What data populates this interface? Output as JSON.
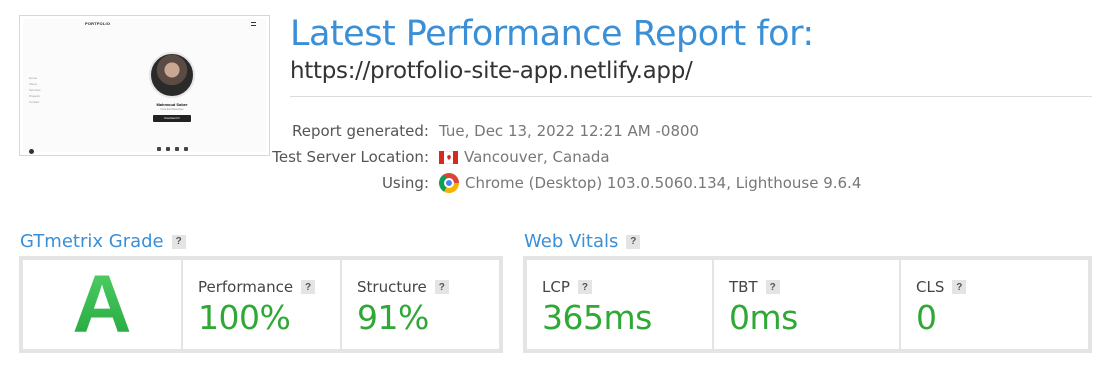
{
  "thumbnail": {
    "brand": "PORTFOLIO",
    "nav_items": [
      "Home",
      "About",
      "Services",
      "Projects",
      "Contact"
    ],
    "name": "Mahmoud Saber",
    "role": "Front-End Developer",
    "button": "Download CV"
  },
  "header": {
    "title": "Latest Performance Report for:",
    "url": "https://protfolio-site-app.netlify.app/"
  },
  "info": {
    "generated_label": "Report generated:",
    "generated_value": "Tue, Dec 13, 2022 12:21 AM -0800",
    "location_label": "Test Server Location:",
    "location_value": "Vancouver, Canada",
    "using_label": "Using:",
    "using_value": "Chrome (Desktop) 103.0.5060.134, Lighthouse 9.6.4"
  },
  "gtmetrix": {
    "title": "GTmetrix Grade",
    "grade": "A",
    "performance_label": "Performance",
    "performance_value": "100%",
    "structure_label": "Structure",
    "structure_value": "91%"
  },
  "vitals": {
    "title": "Web Vitals",
    "lcp_label": "LCP",
    "lcp_value": "365ms",
    "tbt_label": "TBT",
    "tbt_value": "0ms",
    "cls_label": "CLS",
    "cls_value": "0"
  },
  "help_glyph": "?",
  "colors": {
    "accent": "#3a8fd6",
    "good": "#2fa836",
    "grade": "#2eb84a"
  }
}
